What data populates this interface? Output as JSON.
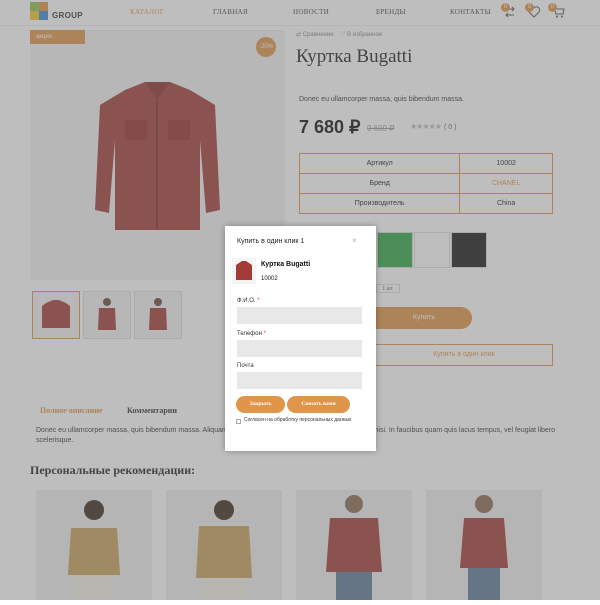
{
  "header": {
    "logo_text": "GROUP",
    "nav": [
      "Каталог",
      "Главная",
      "Новости",
      "Бренды",
      "Контакты"
    ],
    "nav_active_index": 0,
    "compare_count": "0",
    "favorites_count": "0",
    "cart_count": "0"
  },
  "product": {
    "promo_badge": "акция",
    "discount_badge": "-20%",
    "compare_label": "Сравнение",
    "favorite_label": "В избранное",
    "title": "Куртка Bugatti",
    "short_desc": "Donec eu ullamcorper massa, quis bibendum massa.",
    "price": "7 680 ₽",
    "old_price": "9 600 ₽",
    "rating_count": "( 0 )",
    "specs": [
      {
        "key": "Артикул",
        "value": "10002"
      },
      {
        "key": "Бренд",
        "value": "CHANEL"
      },
      {
        "key": "Производитель",
        "value": "China"
      }
    ],
    "swatch_colors": [
      "#2ea84a",
      "#ffffff",
      "#1a1a1a"
    ],
    "qty_value": "1 шт.",
    "buy_button": "Купить",
    "one_click_button": "Купить в один клик"
  },
  "tabs": [
    "Полное описание",
    "Комментарии"
  ],
  "long_desc": "Donec eu ullamcorper massa, quis bibendum massa. Aliquam ... commodo non tincidunt sit amet, pulvinar at nisi. In faucibus quam quis lacus tempus, vel feugiat libero scelerisque.",
  "recommendations": {
    "title": "Персональные рекомендации:"
  },
  "modal": {
    "title": "Купить в один клик 1",
    "close": "×",
    "product_name": "Куртка Bugatti",
    "product_article": "10002",
    "name_label": "Ф.И.О.",
    "phone_label": "Телефон",
    "email_label": "Почта",
    "required_mark": "*",
    "close_button": "Закрыть",
    "call_button": "Связать вами",
    "agree_text": "Согласен на обработку персональных данных"
  },
  "colors": {
    "accent": "#e0964a"
  }
}
